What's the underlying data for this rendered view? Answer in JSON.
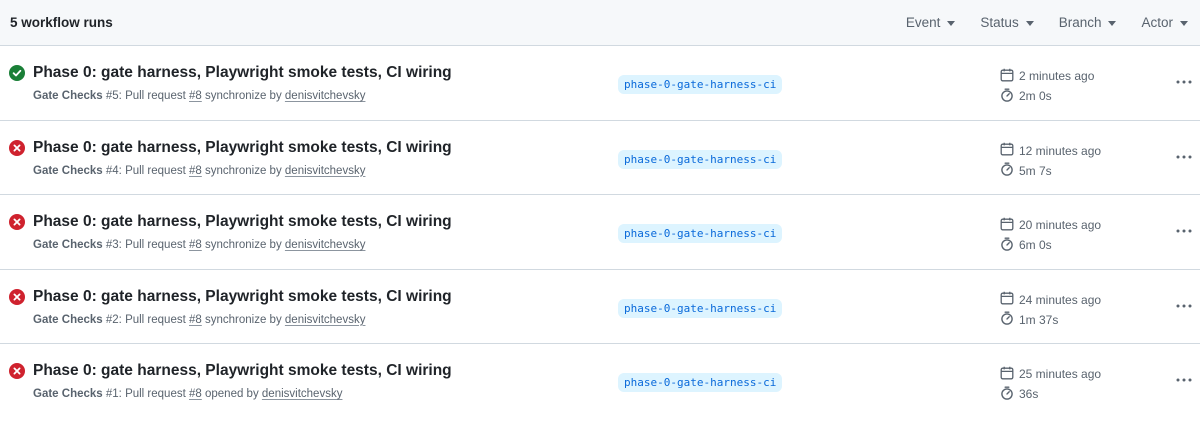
{
  "header": {
    "count_label": "5 workflow runs",
    "filters": [
      {
        "label": "Event"
      },
      {
        "label": "Status"
      },
      {
        "label": "Branch"
      },
      {
        "label": "Actor"
      }
    ]
  },
  "colors": {
    "success": "#1a7f37",
    "failure": "#cf222e",
    "branch_bg": "#ddf4ff",
    "branch_fg": "#0969da",
    "muted": "#59636e"
  },
  "runs": [
    {
      "status": "success",
      "status_icon": "check-circle-icon",
      "title": "Phase 0: gate harness, Playwright smoke tests, CI wiring",
      "workflow": "Gate Checks",
      "run_label": " #5: Pull request ",
      "pr": "#8",
      "event_text": " synchronize by ",
      "actor": "denisvitchevsky",
      "branch": "phase-0-gate-harness-ci",
      "started": "2 minutes ago",
      "duration": "2m 0s"
    },
    {
      "status": "failure",
      "status_icon": "x-circle-icon",
      "title": "Phase 0: gate harness, Playwright smoke tests, CI wiring",
      "workflow": "Gate Checks",
      "run_label": " #4: Pull request ",
      "pr": "#8",
      "event_text": " synchronize by ",
      "actor": "denisvitchevsky",
      "branch": "phase-0-gate-harness-ci",
      "started": "12 minutes ago",
      "duration": "5m 7s"
    },
    {
      "status": "failure",
      "status_icon": "x-circle-icon",
      "title": "Phase 0: gate harness, Playwright smoke tests, CI wiring",
      "workflow": "Gate Checks",
      "run_label": " #3: Pull request ",
      "pr": "#8",
      "event_text": " synchronize by ",
      "actor": "denisvitchevsky",
      "branch": "phase-0-gate-harness-ci",
      "started": "20 minutes ago",
      "duration": "6m 0s"
    },
    {
      "status": "failure",
      "status_icon": "x-circle-icon",
      "title": "Phase 0: gate harness, Playwright smoke tests, CI wiring",
      "workflow": "Gate Checks",
      "run_label": " #2: Pull request ",
      "pr": "#8",
      "event_text": " synchronize by ",
      "actor": "denisvitchevsky",
      "branch": "phase-0-gate-harness-ci",
      "started": "24 minutes ago",
      "duration": "1m 37s"
    },
    {
      "status": "failure",
      "status_icon": "x-circle-icon",
      "title": "Phase 0: gate harness, Playwright smoke tests, CI wiring",
      "workflow": "Gate Checks",
      "run_label": " #1: Pull request ",
      "pr": "#8",
      "event_text": " opened by ",
      "actor": "denisvitchevsky",
      "branch": "phase-0-gate-harness-ci",
      "started": "25 minutes ago",
      "duration": "36s"
    }
  ]
}
